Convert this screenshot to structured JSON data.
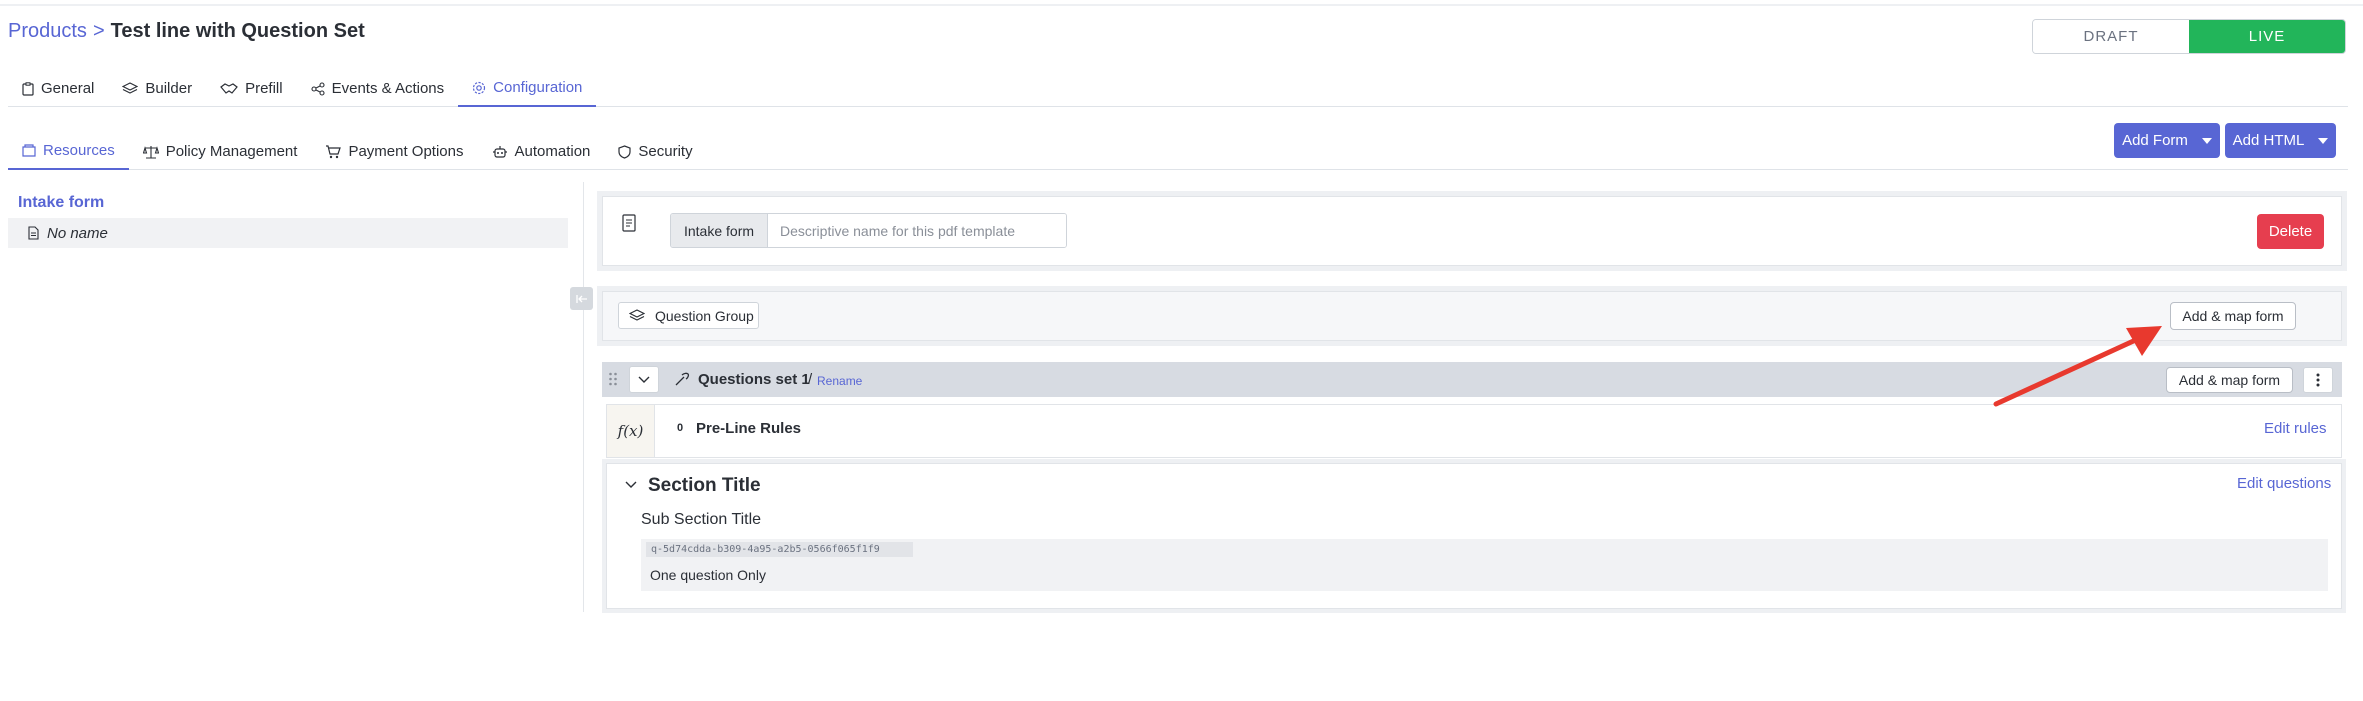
{
  "breadcrumb": {
    "root": "Products",
    "separator": ">",
    "current": "Test line with Question Set"
  },
  "status_toggle": {
    "draft": "DRAFT",
    "live": "LIVE",
    "active": "LIVE",
    "live_color": "#22b55a"
  },
  "main_tabs": [
    {
      "label": "General",
      "icon": "clipboard-icon"
    },
    {
      "label": "Builder",
      "icon": "layers-icon"
    },
    {
      "label": "Prefill",
      "icon": "handshake-icon"
    },
    {
      "label": "Events & Actions",
      "icon": "share-nodes-icon"
    },
    {
      "label": "Configuration",
      "icon": "gear-icon",
      "active": true
    }
  ],
  "sub_tabs": [
    {
      "label": "Resources",
      "icon": "folder-icon",
      "active": true
    },
    {
      "label": "Policy Management",
      "icon": "scale-icon"
    },
    {
      "label": "Payment Options",
      "icon": "cart-icon"
    },
    {
      "label": "Automation",
      "icon": "robot-icon"
    },
    {
      "label": "Security",
      "icon": "shield-icon"
    }
  ],
  "toolbar": {
    "add_form": "Add Form",
    "add_html": "Add HTML",
    "accent": "#5866d4"
  },
  "sidebar": {
    "heading": "Intake form",
    "items": [
      {
        "label": "No name",
        "icon": "document-icon"
      }
    ]
  },
  "form_panel": {
    "prefix": "Intake form",
    "name_value": "",
    "name_placeholder": "Descriptive name for this pdf template",
    "delete_label": "Delete",
    "danger_color": "#e63e4f"
  },
  "question_group": {
    "label": "Question Group",
    "add_map_label": "Add & map form"
  },
  "question_set": {
    "title": "Questions set 1",
    "slash": "/",
    "rename": "Rename",
    "add_map_label": "Add & map form"
  },
  "rules": {
    "fx": "f(x)",
    "count": "0",
    "label": "Pre-Line Rules",
    "edit": "Edit rules"
  },
  "section": {
    "title": "Section Title",
    "edit": "Edit questions",
    "subsection": "Sub Section Title",
    "question_id": "q-5d74cdda-b309-4a95-a2b5-0566f065f1f9",
    "question_text": "One question Only"
  },
  "annotation": {
    "arrow_color": "#e8392e"
  }
}
